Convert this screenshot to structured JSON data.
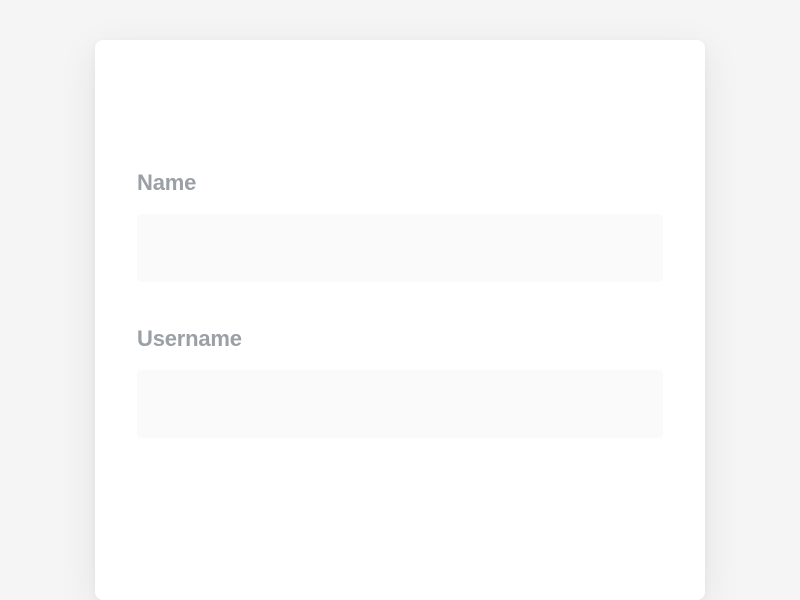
{
  "form": {
    "fields": [
      {
        "label": "Name",
        "value": "",
        "placeholder": ""
      },
      {
        "label": "Username",
        "value": "",
        "placeholder": ""
      }
    ]
  }
}
